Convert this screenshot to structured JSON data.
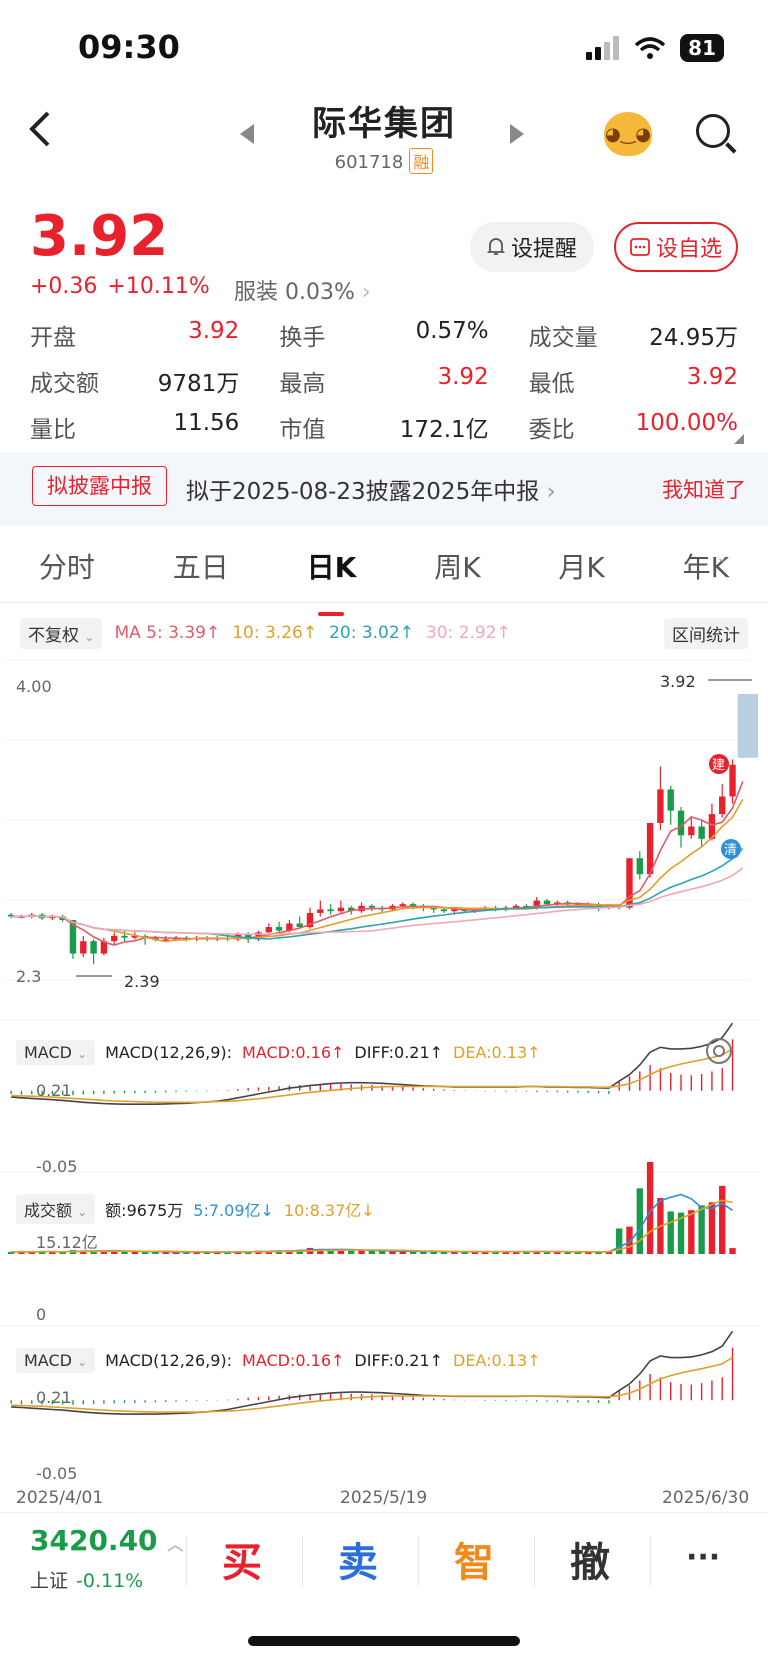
{
  "status": {
    "time": "09:30",
    "battery": "81"
  },
  "header": {
    "title": "际华集团",
    "code": "601718",
    "tag": "融"
  },
  "quote": {
    "price": "3.92",
    "change": "+0.36",
    "change_pct": "+10.11%",
    "sector": "服装 0.03%",
    "alert_label": "设提醒",
    "fav_label": "设自选"
  },
  "stats": [
    {
      "label": "开盘",
      "value": "3.92",
      "color": "red"
    },
    {
      "label": "换手",
      "value": "0.57%",
      "color": ""
    },
    {
      "label": "成交量",
      "value": "24.95万",
      "color": ""
    },
    {
      "label": "成交额",
      "value": "9781万",
      "color": ""
    },
    {
      "label": "最高",
      "value": "3.92",
      "color": "red"
    },
    {
      "label": "最低",
      "value": "3.92",
      "color": "red"
    },
    {
      "label": "量比",
      "value": "11.56",
      "color": ""
    },
    {
      "label": "市值",
      "value": "172.1亿",
      "color": ""
    },
    {
      "label": "委比",
      "value": "100.00%",
      "color": "red"
    }
  ],
  "banner": {
    "tag": "拟披露中报",
    "text": "拟于2025-08-23披露2025年中报",
    "dismiss": "我知道了"
  },
  "tabs": [
    {
      "label": "分时",
      "active": false
    },
    {
      "label": "五日",
      "active": false
    },
    {
      "label": "日K",
      "active": true
    },
    {
      "label": "周K",
      "active": false
    },
    {
      "label": "月K",
      "active": false
    },
    {
      "label": "年K",
      "active": false
    }
  ],
  "ma_row": {
    "adjust": "不复权",
    "ma5": "MA 5: 3.39↑",
    "ma10": "10: 3.26↑",
    "ma20": "20: 3.02↑",
    "ma30": "30: 2.92↑",
    "range_stat": "区间统计"
  },
  "kline": {
    "y_top": "4.00",
    "y_bottom": "2.3",
    "last_price": "3.92",
    "low_label": "2.39",
    "marker_buy": "建",
    "marker_clear": "清"
  },
  "macd1": {
    "selector": "MACD",
    "params": "MACD(12,26,9):",
    "macd": "MACD:0.16↑",
    "diff": "DIFF:0.21↑",
    "dea": "DEA:0.13↑",
    "y_top": "0.21",
    "y_bottom": "-0.05"
  },
  "volume": {
    "selector": "成交额",
    "amount": "额:9675万",
    "ma5": "5:7.09亿↓",
    "ma10": "10:8.37亿↓",
    "y_top": "15.12亿",
    "y_bottom": "0"
  },
  "macd2": {
    "selector": "MACD",
    "params": "MACD(12,26,9):",
    "macd": "MACD:0.16↑",
    "diff": "DIFF:0.21↑",
    "dea": "DEA:0.13↑",
    "y_top": "0.21",
    "y_bottom": "-0.05"
  },
  "dates": [
    "2025/4/01",
    "2025/5/19",
    "2025/6/30"
  ],
  "bottom": {
    "index_value": "3420.40",
    "index_name": "上证",
    "index_change": "-0.11%",
    "buy": "买",
    "sell": "卖",
    "smart": "智",
    "cancel": "撤",
    "more": "···"
  },
  "colors": {
    "up": "#e8222d",
    "down": "#1a9b4a",
    "ma5": "#e5596a",
    "ma10": "#e0a02a",
    "ma20": "#2ba3b5",
    "ma30": "#f2a8b5"
  },
  "candles": [
    {
      "o": 2.67,
      "c": 2.66,
      "h": 2.68,
      "l": 2.65
    },
    {
      "o": 2.66,
      "c": 2.66,
      "h": 2.67,
      "l": 2.65
    },
    {
      "o": 2.66,
      "c": 2.67,
      "h": 2.68,
      "l": 2.65
    },
    {
      "o": 2.67,
      "c": 2.65,
      "h": 2.68,
      "l": 2.64
    },
    {
      "o": 2.65,
      "c": 2.66,
      "h": 2.67,
      "l": 2.64
    },
    {
      "o": 2.66,
      "c": 2.64,
      "h": 2.67,
      "l": 2.63
    },
    {
      "o": 2.64,
      "c": 2.45,
      "h": 2.64,
      "l": 2.42
    },
    {
      "o": 2.45,
      "c": 2.52,
      "h": 2.55,
      "l": 2.43
    },
    {
      "o": 2.52,
      "c": 2.45,
      "h": 2.53,
      "l": 2.39
    },
    {
      "o": 2.45,
      "c": 2.52,
      "h": 2.54,
      "l": 2.44
    },
    {
      "o": 2.52,
      "c": 2.55,
      "h": 2.57,
      "l": 2.5
    },
    {
      "o": 2.55,
      "c": 2.54,
      "h": 2.58,
      "l": 2.52
    },
    {
      "o": 2.54,
      "c": 2.55,
      "h": 2.57,
      "l": 2.53
    },
    {
      "o": 2.55,
      "c": 2.54,
      "h": 2.56,
      "l": 2.5
    },
    {
      "o": 2.54,
      "c": 2.53,
      "h": 2.55,
      "l": 2.52
    },
    {
      "o": 2.53,
      "c": 2.53,
      "h": 2.55,
      "l": 2.52
    },
    {
      "o": 2.53,
      "c": 2.54,
      "h": 2.55,
      "l": 2.52
    },
    {
      "o": 2.54,
      "c": 2.53,
      "h": 2.55,
      "l": 2.52
    },
    {
      "o": 2.53,
      "c": 2.54,
      "h": 2.55,
      "l": 2.52
    },
    {
      "o": 2.54,
      "c": 2.53,
      "h": 2.55,
      "l": 2.52
    },
    {
      "o": 2.53,
      "c": 2.54,
      "h": 2.55,
      "l": 2.52
    },
    {
      "o": 2.54,
      "c": 2.53,
      "h": 2.56,
      "l": 2.52
    },
    {
      "o": 2.53,
      "c": 2.56,
      "h": 2.57,
      "l": 2.52
    },
    {
      "o": 2.56,
      "c": 2.53,
      "h": 2.57,
      "l": 2.51
    },
    {
      "o": 2.53,
      "c": 2.57,
      "h": 2.58,
      "l": 2.52
    },
    {
      "o": 2.57,
      "c": 2.6,
      "h": 2.62,
      "l": 2.55
    },
    {
      "o": 2.6,
      "c": 2.58,
      "h": 2.63,
      "l": 2.57
    },
    {
      "o": 2.58,
      "c": 2.62,
      "h": 2.64,
      "l": 2.57
    },
    {
      "o": 2.62,
      "c": 2.6,
      "h": 2.66,
      "l": 2.59
    },
    {
      "o": 2.6,
      "c": 2.68,
      "h": 2.71,
      "l": 2.59
    },
    {
      "o": 2.68,
      "c": 2.7,
      "h": 2.75,
      "l": 2.66
    },
    {
      "o": 2.7,
      "c": 2.69,
      "h": 2.73,
      "l": 2.67
    },
    {
      "o": 2.69,
      "c": 2.71,
      "h": 2.75,
      "l": 2.68
    },
    {
      "o": 2.71,
      "c": 2.69,
      "h": 2.72,
      "l": 2.67
    },
    {
      "o": 2.69,
      "c": 2.72,
      "h": 2.74,
      "l": 2.68
    },
    {
      "o": 2.72,
      "c": 2.71,
      "h": 2.73,
      "l": 2.69
    },
    {
      "o": 2.71,
      "c": 2.7,
      "h": 2.72,
      "l": 2.68
    },
    {
      "o": 2.7,
      "c": 2.72,
      "h": 2.73,
      "l": 2.69
    },
    {
      "o": 2.72,
      "c": 2.73,
      "h": 2.74,
      "l": 2.7
    },
    {
      "o": 2.73,
      "c": 2.72,
      "h": 2.74,
      "l": 2.7
    },
    {
      "o": 2.72,
      "c": 2.71,
      "h": 2.73,
      "l": 2.69
    },
    {
      "o": 2.71,
      "c": 2.7,
      "h": 2.72,
      "l": 2.68
    },
    {
      "o": 2.7,
      "c": 2.69,
      "h": 2.71,
      "l": 2.68
    },
    {
      "o": 2.69,
      "c": 2.7,
      "h": 2.71,
      "l": 2.67
    },
    {
      "o": 2.7,
      "c": 2.69,
      "h": 2.71,
      "l": 2.68
    },
    {
      "o": 2.69,
      "c": 2.7,
      "h": 2.71,
      "l": 2.68
    },
    {
      "o": 2.7,
      "c": 2.71,
      "h": 2.72,
      "l": 2.69
    },
    {
      "o": 2.71,
      "c": 2.7,
      "h": 2.72,
      "l": 2.69
    },
    {
      "o": 2.7,
      "c": 2.71,
      "h": 2.72,
      "l": 2.69
    },
    {
      "o": 2.71,
      "c": 2.72,
      "h": 2.73,
      "l": 2.7
    },
    {
      "o": 2.72,
      "c": 2.71,
      "h": 2.73,
      "l": 2.7
    },
    {
      "o": 2.71,
      "c": 2.75,
      "h": 2.77,
      "l": 2.7
    },
    {
      "o": 2.75,
      "c": 2.73,
      "h": 2.76,
      "l": 2.72
    },
    {
      "o": 2.73,
      "c": 2.74,
      "h": 2.75,
      "l": 2.72
    },
    {
      "o": 2.74,
      "c": 2.73,
      "h": 2.75,
      "l": 2.72
    },
    {
      "o": 2.73,
      "c": 2.72,
      "h": 2.74,
      "l": 2.71
    },
    {
      "o": 2.72,
      "c": 2.73,
      "h": 2.74,
      "l": 2.71
    },
    {
      "o": 2.73,
      "c": 2.71,
      "h": 2.74,
      "l": 2.69
    },
    {
      "o": 2.71,
      "c": 2.72,
      "h": 2.73,
      "l": 2.7
    },
    {
      "o": 2.72,
      "c": 2.71,
      "h": 2.73,
      "l": 2.7
    },
    {
      "o": 2.71,
      "c": 2.99,
      "h": 2.99,
      "l": 2.7
    },
    {
      "o": 2.99,
      "c": 2.9,
      "h": 3.03,
      "l": 2.87
    },
    {
      "o": 2.9,
      "c": 3.19,
      "h": 3.19,
      "l": 2.88
    },
    {
      "o": 3.19,
      "c": 3.38,
      "h": 3.51,
      "l": 3.15
    },
    {
      "o": 3.38,
      "c": 3.26,
      "h": 3.4,
      "l": 3.18
    },
    {
      "o": 3.26,
      "c": 3.12,
      "h": 3.28,
      "l": 3.05
    },
    {
      "o": 3.12,
      "c": 3.17,
      "h": 3.22,
      "l": 3.1
    },
    {
      "o": 3.17,
      "c": 3.1,
      "h": 3.2,
      "l": 3.05
    },
    {
      "o": 3.1,
      "c": 3.24,
      "h": 3.3,
      "l": 3.09
    },
    {
      "o": 3.24,
      "c": 3.34,
      "h": 3.41,
      "l": 3.22
    },
    {
      "o": 3.34,
      "c": 3.52,
      "h": 3.55,
      "l": 3.3
    },
    {
      "o": 3.56,
      "c": 3.92,
      "h": 3.92,
      "l": 3.92
    }
  ],
  "macd_hist": [
    -0.01,
    -0.012,
    -0.011,
    -0.013,
    -0.012,
    -0.013,
    -0.014,
    -0.012,
    -0.011,
    -0.01,
    -0.009,
    -0.008,
    -0.008,
    -0.007,
    -0.006,
    -0.005,
    -0.004,
    -0.003,
    -0.002,
    -0.002,
    -0.001,
    0.002,
    0.005,
    0.008,
    0.01,
    0.012,
    0.014,
    0.016,
    0.018,
    0.019,
    0.02,
    0.021,
    0.021,
    0.02,
    0.019,
    0.018,
    0.016,
    0.014,
    0.012,
    0.01,
    0.008,
    0.006,
    0.004,
    0.002,
    0.001,
    -0.001,
    -0.002,
    -0.002,
    -0.003,
    -0.002,
    -0.003,
    -0.004,
    -0.004,
    -0.005,
    -0.006,
    -0.006,
    -0.007,
    -0.008,
    -0.01,
    0.03,
    0.045,
    0.06,
    0.08,
    0.07,
    0.055,
    0.05,
    0.048,
    0.052,
    0.06,
    0.07,
    0.16
  ],
  "macd_diff": [
    -0.02,
    -0.022,
    -0.024,
    -0.026,
    -0.028,
    -0.03,
    -0.033,
    -0.036,
    -0.038,
    -0.04,
    -0.041,
    -0.042,
    -0.042,
    -0.042,
    -0.042,
    -0.041,
    -0.04,
    -0.039,
    -0.037,
    -0.035,
    -0.032,
    -0.028,
    -0.022,
    -0.016,
    -0.01,
    -0.004,
    0.002,
    0.008,
    0.012,
    0.016,
    0.019,
    0.022,
    0.024,
    0.025,
    0.025,
    0.024,
    0.023,
    0.021,
    0.019,
    0.017,
    0.015,
    0.014,
    0.013,
    0.012,
    0.012,
    0.012,
    0.012,
    0.012,
    0.012,
    0.012,
    0.013,
    0.013,
    0.012,
    0.012,
    0.011,
    0.01,
    0.01,
    0.009,
    0.008,
    0.03,
    0.05,
    0.08,
    0.12,
    0.135,
    0.13,
    0.13,
    0.132,
    0.138,
    0.148,
    0.165,
    0.21
  ],
  "macd_dea": [
    -0.015,
    -0.016,
    -0.017,
    -0.018,
    -0.02,
    -0.022,
    -0.024,
    -0.026,
    -0.028,
    -0.03,
    -0.032,
    -0.033,
    -0.034,
    -0.035,
    -0.036,
    -0.036,
    -0.036,
    -0.036,
    -0.036,
    -0.035,
    -0.034,
    -0.033,
    -0.031,
    -0.028,
    -0.025,
    -0.021,
    -0.017,
    -0.013,
    -0.009,
    -0.005,
    -0.002,
    0.001,
    0.004,
    0.007,
    0.009,
    0.011,
    0.012,
    0.013,
    0.013,
    0.013,
    0.013,
    0.013,
    0.013,
    0.013,
    0.013,
    0.013,
    0.013,
    0.013,
    0.013,
    0.013,
    0.013,
    0.013,
    0.013,
    0.013,
    0.012,
    0.012,
    0.012,
    0.011,
    0.011,
    0.015,
    0.022,
    0.034,
    0.05,
    0.065,
    0.075,
    0.083,
    0.09,
    0.096,
    0.103,
    0.111,
    0.13
  ],
  "volume_values": [
    0.35,
    0.4,
    0.3,
    0.45,
    0.35,
    0.3,
    0.65,
    0.55,
    0.6,
    0.45,
    0.5,
    0.4,
    0.35,
    0.3,
    0.4,
    0.35,
    0.3,
    0.3,
    0.35,
    0.3,
    0.3,
    0.35,
    0.4,
    0.35,
    0.55,
    0.5,
    0.6,
    0.5,
    0.7,
    1.0,
    0.8,
    0.6,
    0.7,
    0.55,
    0.6,
    0.5,
    0.45,
    0.4,
    0.45,
    0.4,
    0.35,
    0.4,
    0.35,
    0.4,
    0.35,
    0.4,
    0.35,
    0.4,
    0.35,
    0.4,
    0.45,
    0.35,
    0.4,
    0.35,
    0.3,
    0.35,
    0.4,
    0.35,
    0.4,
    4.2,
    4.5,
    10.8,
    15.12,
    9.2,
    7.0,
    6.8,
    7.2,
    8.0,
    8.5,
    11.2,
    0.97
  ]
}
